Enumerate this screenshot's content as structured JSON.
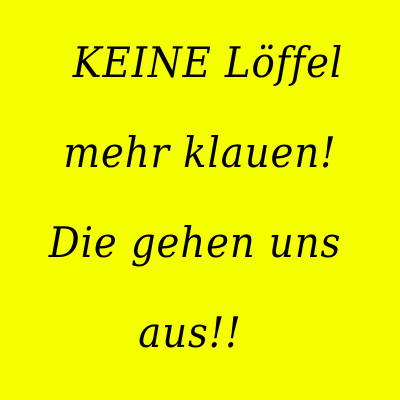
{
  "note": {
    "background_color": "#f5ff00",
    "lines": [
      "KEINE Löffel",
      "mehr klauen!",
      "Die gehen uns",
      "aus!!"
    ]
  }
}
